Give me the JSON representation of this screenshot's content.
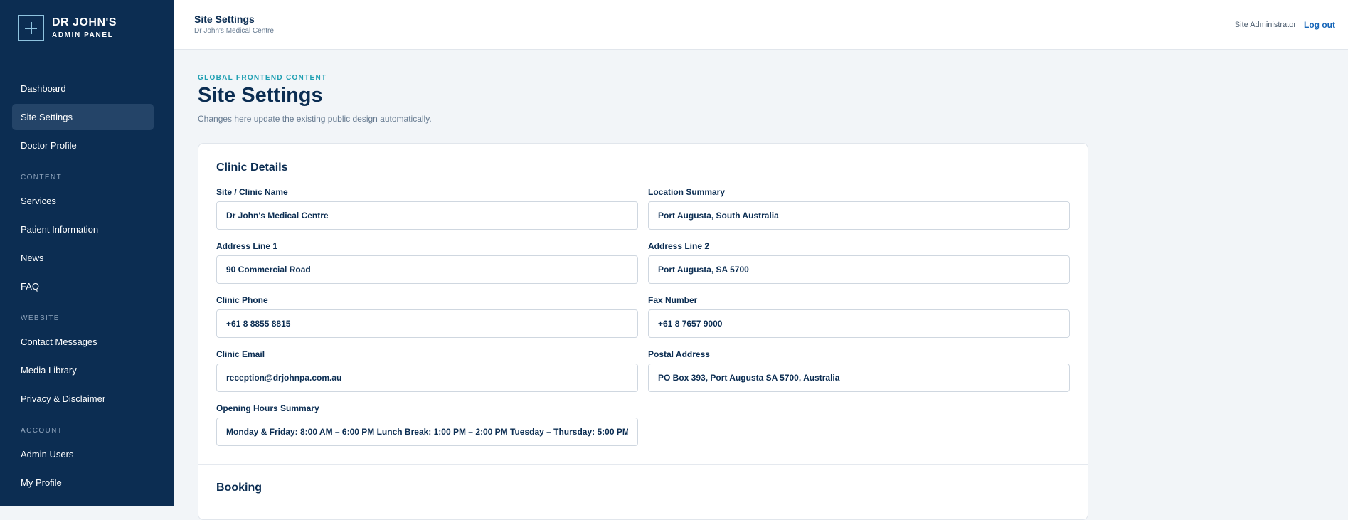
{
  "brand": {
    "name": "DR JOHN'S",
    "subtitle": "ADMIN PANEL"
  },
  "nav": {
    "dashboard": "Dashboard",
    "site_settings": "Site Settings",
    "doctor_profile": "Doctor Profile",
    "section_content": "CONTENT",
    "services": "Services",
    "patient_information": "Patient Information",
    "news": "News",
    "faq": "FAQ",
    "section_website": "WEBSITE",
    "contact_messages": "Contact Messages",
    "media_library": "Media Library",
    "privacy_disclaimer": "Privacy & Disclaimer",
    "section_account": "ACCOUNT",
    "admin_users": "Admin Users",
    "my_profile": "My Profile"
  },
  "topbar": {
    "title": "Site Settings",
    "subtitle": "Dr John's Medical Centre",
    "user": "Site Administrator",
    "logout": "Log out"
  },
  "page": {
    "eyebrow": "GLOBAL FRONTEND CONTENT",
    "title": "Site Settings",
    "description": "Changes here update the existing public design automatically."
  },
  "clinic_details": {
    "heading": "Clinic Details",
    "site_name": {
      "label": "Site / Clinic Name",
      "value": "Dr John's Medical Centre"
    },
    "location_summary": {
      "label": "Location Summary",
      "value": "Port Augusta, South Australia"
    },
    "address_line_1": {
      "label": "Address Line 1",
      "value": "90 Commercial Road"
    },
    "address_line_2": {
      "label": "Address Line 2",
      "value": "Port Augusta, SA 5700"
    },
    "clinic_phone": {
      "label": "Clinic Phone",
      "value": "+61 8 8855 8815"
    },
    "fax_number": {
      "label": "Fax Number",
      "value": "+61 8 7657 9000"
    },
    "clinic_email": {
      "label": "Clinic Email",
      "value": "reception@drjohnpa.com.au"
    },
    "postal_address": {
      "label": "Postal Address",
      "value": "PO Box 393, Port Augusta SA 5700, Australia"
    },
    "opening_hours": {
      "label": "Opening Hours Summary",
      "value": "Monday & Friday: 8:00 AM – 6:00 PM Lunch Break: 1:00 PM – 2:00 PM Tuesday – Thursday: 5:00 PM"
    }
  },
  "booking": {
    "heading": "Booking"
  }
}
